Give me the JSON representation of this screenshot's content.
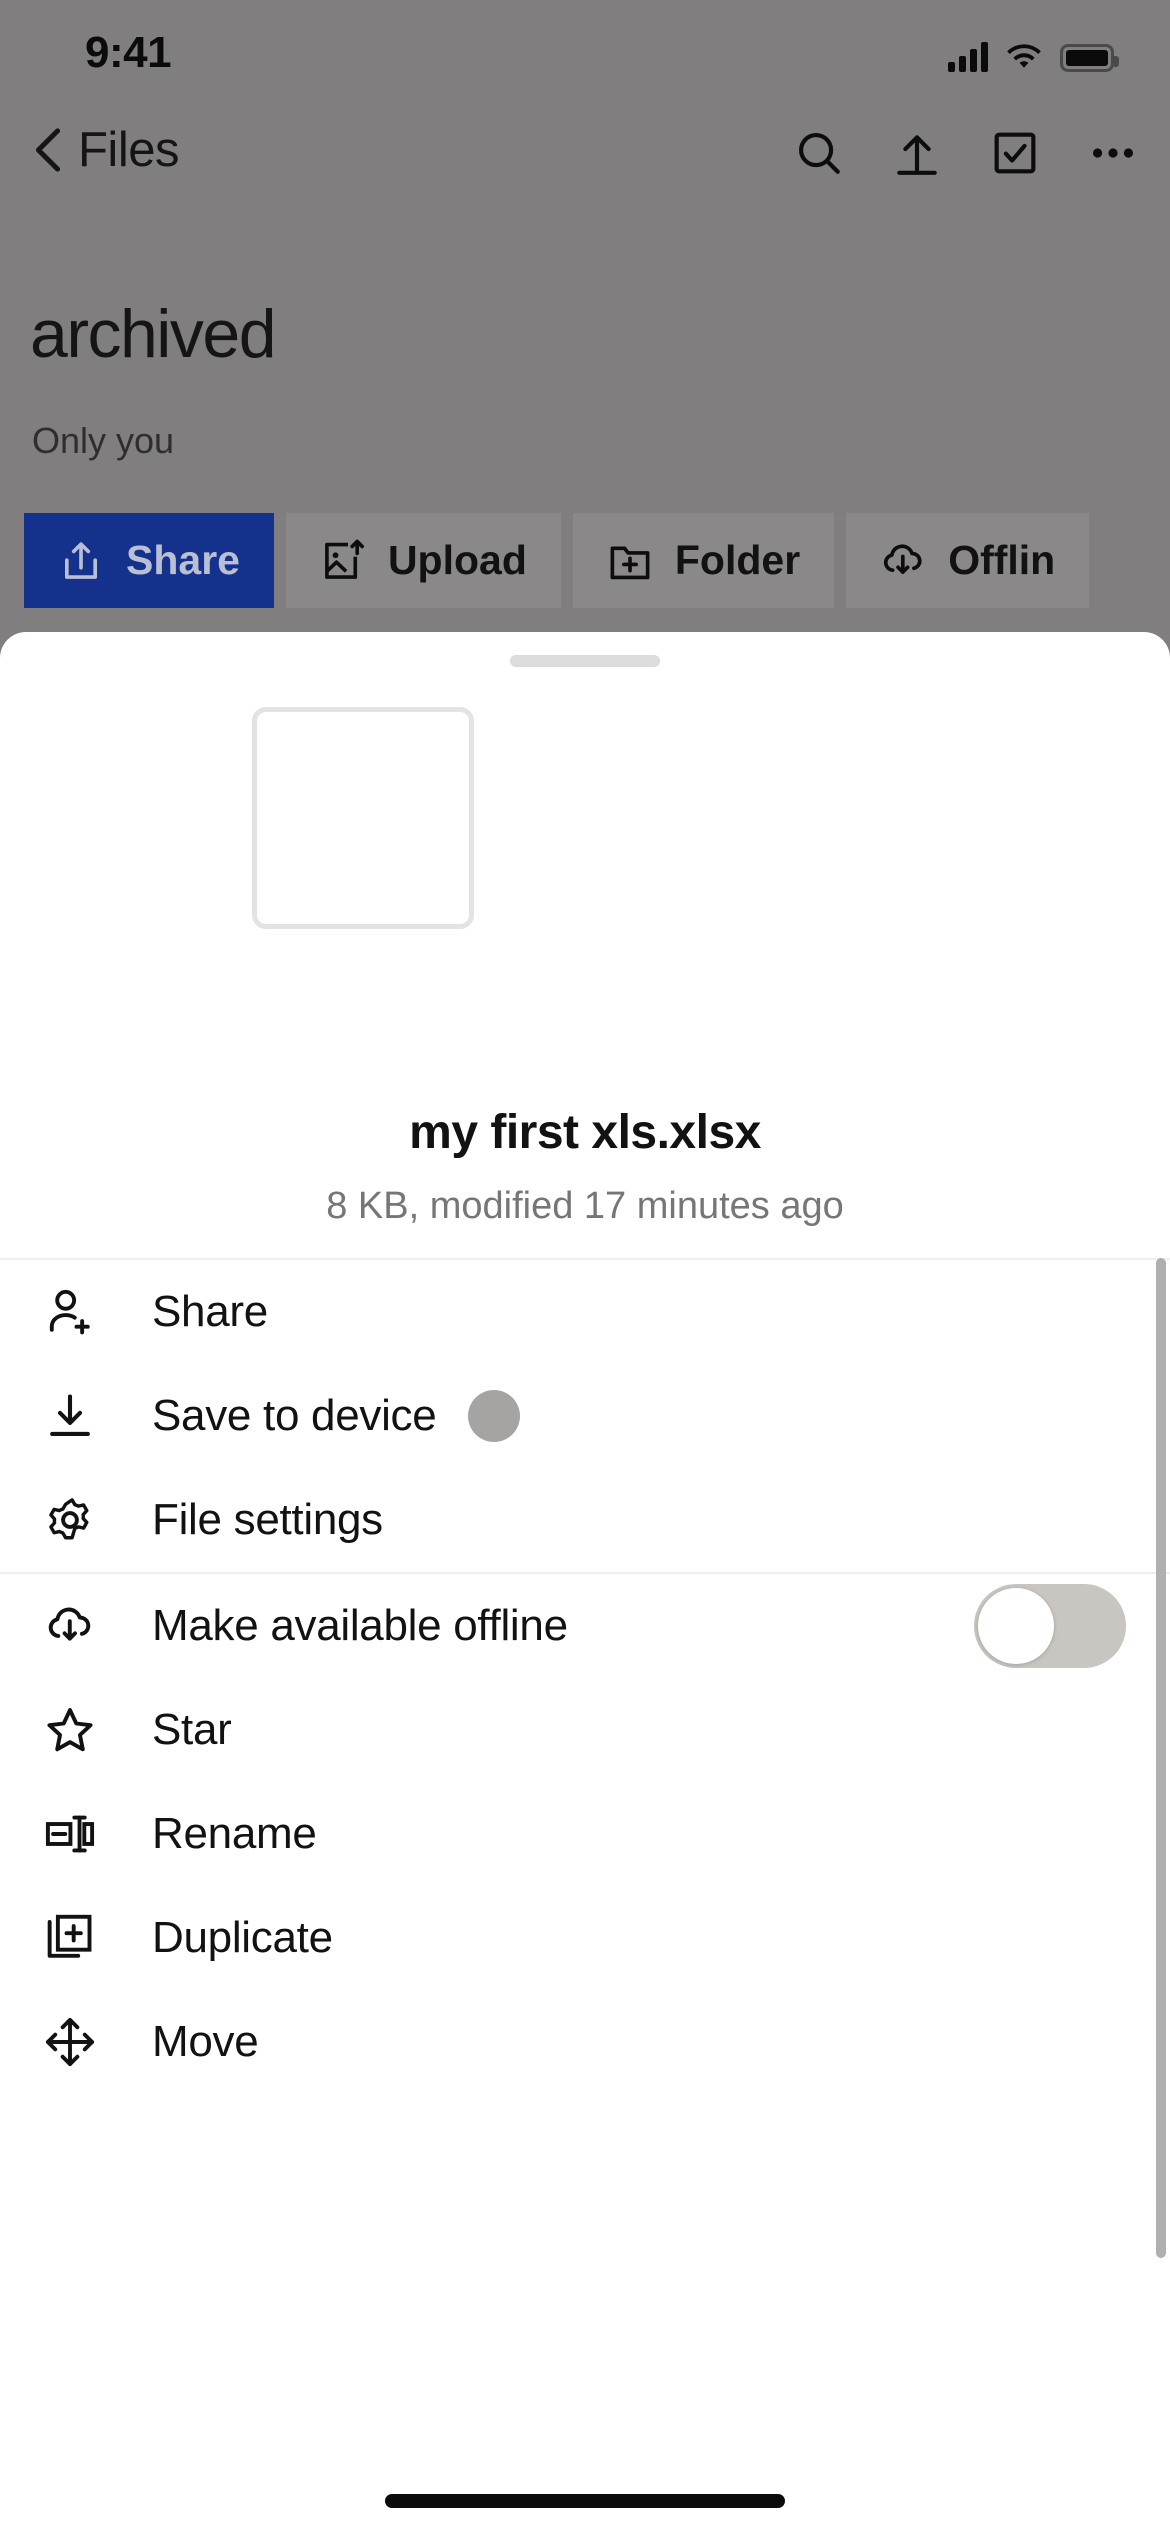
{
  "status_bar": {
    "time": "9:41",
    "cellular_icon": "cellular-signal-icon",
    "wifi_icon": "wifi-icon",
    "battery_icon": "battery-icon"
  },
  "nav_bar": {
    "back_label": "Files",
    "back_icon": "chevron-left-icon",
    "actions": [
      {
        "name": "search",
        "icon": "search-icon"
      },
      {
        "name": "upload",
        "icon": "upload-arrow-icon"
      },
      {
        "name": "select",
        "icon": "checkbox-icon"
      },
      {
        "name": "more",
        "icon": "more-horizontal-icon"
      }
    ]
  },
  "header": {
    "title": "archived",
    "subtitle": "Only you"
  },
  "chips": [
    {
      "label": "Share",
      "icon": "share-upload-icon",
      "primary": true
    },
    {
      "label": "Upload",
      "icon": "image-upload-icon",
      "primary": false
    },
    {
      "label": "Folder",
      "icon": "folder-plus-icon",
      "primary": false
    },
    {
      "label": "Offlin",
      "icon": "cloud-download-icon",
      "primary": false
    }
  ],
  "sheet": {
    "grabber": "drag-handle",
    "preview": {
      "icon": "file-thumbnail-placeholder"
    },
    "file_name": "my first xls.xlsx",
    "file_meta": "8 KB, modified 17 minutes ago",
    "menu_groups": [
      {
        "items": [
          {
            "label": "Share",
            "icon": "person-add-icon",
            "accessory": "none"
          },
          {
            "label": "Save to device",
            "icon": "download-icon",
            "accessory": "spinner"
          },
          {
            "label": "File settings",
            "icon": "gear-icon",
            "accessory": "none"
          }
        ]
      },
      {
        "items": [
          {
            "label": "Make available offline",
            "icon": "cloud-download-icon",
            "accessory": "toggle",
            "toggle_on": false
          },
          {
            "label": "Star",
            "icon": "star-icon",
            "accessory": "none"
          },
          {
            "label": "Rename",
            "icon": "rename-icon",
            "accessory": "none"
          },
          {
            "label": "Duplicate",
            "icon": "duplicate-icon",
            "accessory": "none"
          },
          {
            "label": "Move",
            "icon": "move-icon",
            "accessory": "none"
          }
        ]
      }
    ]
  },
  "colors": {
    "chip_primary_bg": "#14328c",
    "chip_primary_text": "#b9bfd4",
    "chip_bg": "#8a8889",
    "scrim": "#807e7f",
    "sheet_bg": "#ffffff",
    "text_primary": "#121212",
    "text_secondary": "#787675",
    "toggle_track_off": "#c9c5c1",
    "spinner": "#a6a4a3",
    "thumb_border": "#e5e3e1"
  },
  "home_indicator": "home-indicator"
}
